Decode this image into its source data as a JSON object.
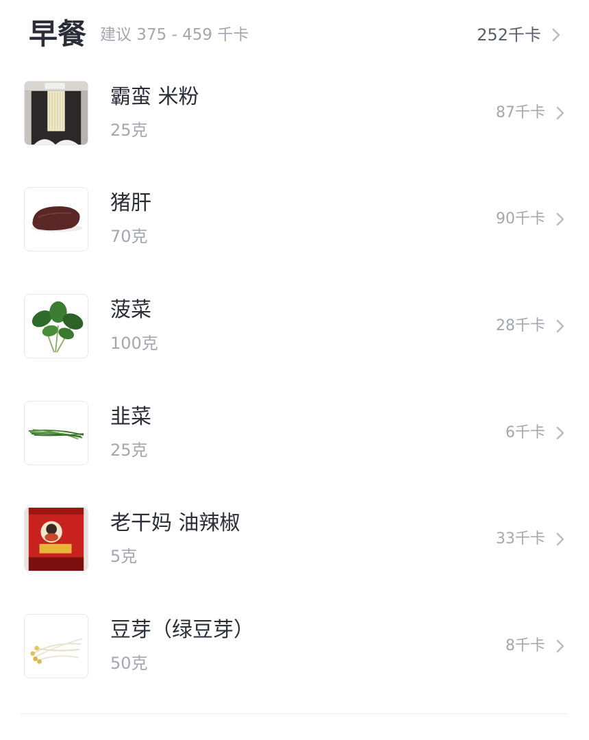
{
  "meal": {
    "title": "早餐",
    "suggestion": "建议 375 - 459 千卡",
    "total": "252千卡"
  },
  "foods": [
    {
      "name": "霸蛮 米粉",
      "weight": "25克",
      "calories": "87千卡",
      "image": "rice-noodle-package-image"
    },
    {
      "name": "猪肝",
      "weight": "70克",
      "calories": "90千卡",
      "image": "pork-liver-image"
    },
    {
      "name": "菠菜",
      "weight": "100克",
      "calories": "28千卡",
      "image": "spinach-image"
    },
    {
      "name": "韭菜",
      "weight": "25克",
      "calories": "6千卡",
      "image": "chives-image"
    },
    {
      "name": "老干妈 油辣椒",
      "weight": "5克",
      "calories": "33千卡",
      "image": "chili-oil-jar-image"
    },
    {
      "name": "豆芽（绿豆芽）",
      "weight": "50克",
      "calories": "8千卡",
      "image": "bean-sprouts-image"
    }
  ],
  "icons": {
    "chevron": "chevron-right-icon"
  },
  "colors": {
    "title": "#2b2d38",
    "secondary_text": "#a4a6b2",
    "chevron": "#b9bbc5"
  }
}
